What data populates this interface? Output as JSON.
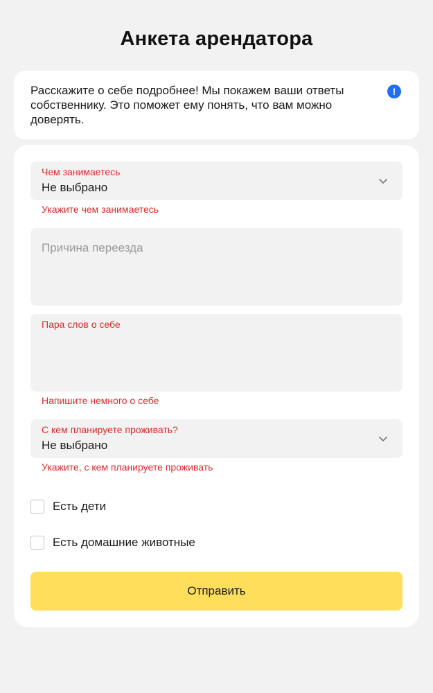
{
  "page": {
    "title": "Анкета арендатора"
  },
  "info": {
    "text": "Расскажите о себе подробнее! Мы покажем ваши ответы собственнику. Это поможет ему понять, что вам можно доверять.",
    "icon": "!",
    "icon_color": "#1f6ff0"
  },
  "form": {
    "occupation": {
      "label": "Чем занимаетесь",
      "value": "Не выбрано",
      "error": "Укажите чем занимаетесь"
    },
    "moving_reason": {
      "placeholder": "Причина переезда",
      "value": ""
    },
    "about": {
      "label": "Пара слов о себе",
      "value": "",
      "error": "Напишите немного о себе"
    },
    "cohabitants": {
      "label": "С кем планируете проживать?",
      "value": "Не выбрано",
      "error": "Укажите, с кем планируете проживать"
    },
    "has_children": {
      "label": "Есть дети",
      "checked": false
    },
    "has_pets": {
      "label": "Есть домашние животные",
      "checked": false
    },
    "submit_label": "Отправить"
  },
  "colors": {
    "error": "#e02a2a",
    "submit_bg": "#fede5a",
    "field_bg": "#f2f2f2",
    "page_bg": "#f2f2f2"
  }
}
